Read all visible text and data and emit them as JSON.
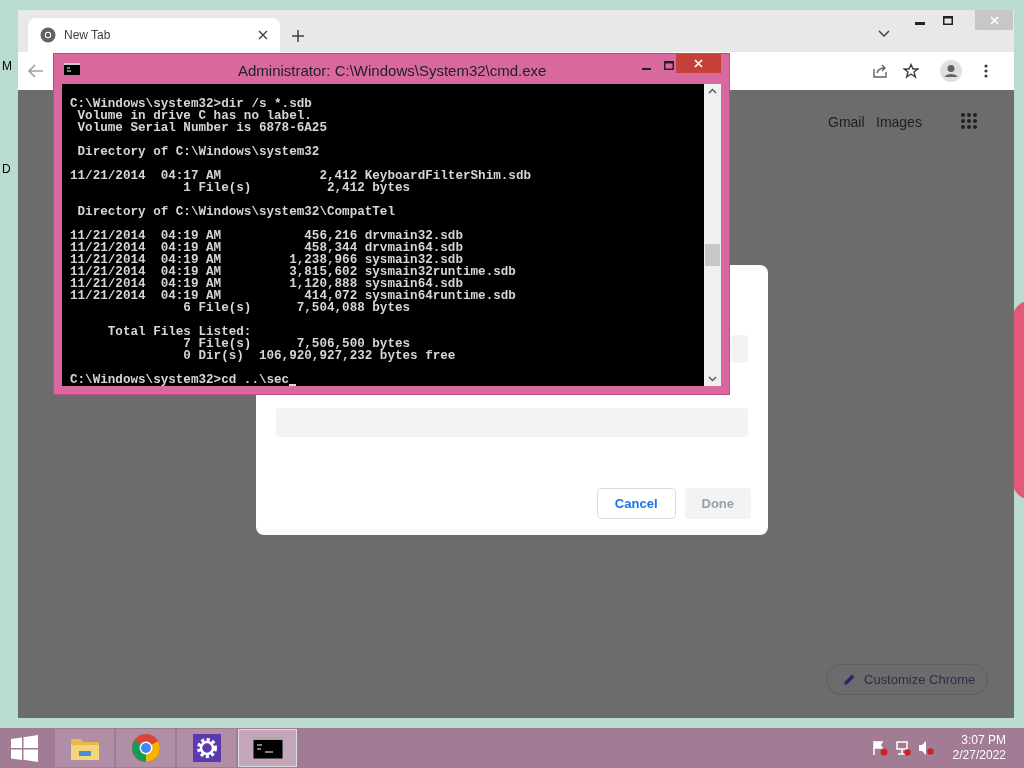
{
  "desktop_labels": [
    "M",
    "D"
  ],
  "browser": {
    "tabs": [
      {
        "label": "New Tab",
        "selected": true
      }
    ],
    "header_links": [
      "Gmail",
      "Images"
    ],
    "dialog": {
      "buttons": [
        {
          "label": "Cancel",
          "disabled": false
        },
        {
          "label": "Done",
          "disabled": true
        }
      ]
    },
    "customize_button": "Customize Chrome"
  },
  "console": {
    "title": "Administrator: C:\\Windows\\System32\\cmd.exe",
    "output": "C:\\Windows\\system32>dir /s *.sdb\n Volume in drive C has no label.\n Volume Serial Number is 6878-6A25\n\n Directory of C:\\Windows\\system32\n\n11/21/2014  04:17 AM             2,412 KeyboardFilterShim.sdb\n               1 File(s)          2,412 bytes\n\n Directory of C:\\Windows\\system32\\CompatTel\n\n11/21/2014  04:19 AM           456,216 drvmain32.sdb\n11/21/2014  04:19 AM           458,344 drvmain64.sdb\n11/21/2014  04:19 AM         1,238,966 sysmain32.sdb\n11/21/2014  04:19 AM         3,815,602 sysmain32runtime.sdb\n11/21/2014  04:19 AM         1,120,888 sysmain64.sdb\n11/21/2014  04:19 AM           414,072 sysmain64runtime.sdb\n               6 File(s)      7,504,088 bytes\n\n     Total Files Listed:\n               7 File(s)      7,506,500 bytes\n               0 Dir(s)  106,920,927,232 bytes free",
    "prompt": "C:\\Windows\\system32>cd ..\\sec"
  },
  "taskbar": {
    "apps": [
      {
        "kind": "folder",
        "selected": false
      },
      {
        "kind": "chrome",
        "selected": false
      },
      {
        "kind": "settings",
        "selected": false
      },
      {
        "kind": "console",
        "selected": true
      }
    ],
    "clock": {
      "time": "3:07 PM",
      "date": "2/27/2022"
    }
  }
}
